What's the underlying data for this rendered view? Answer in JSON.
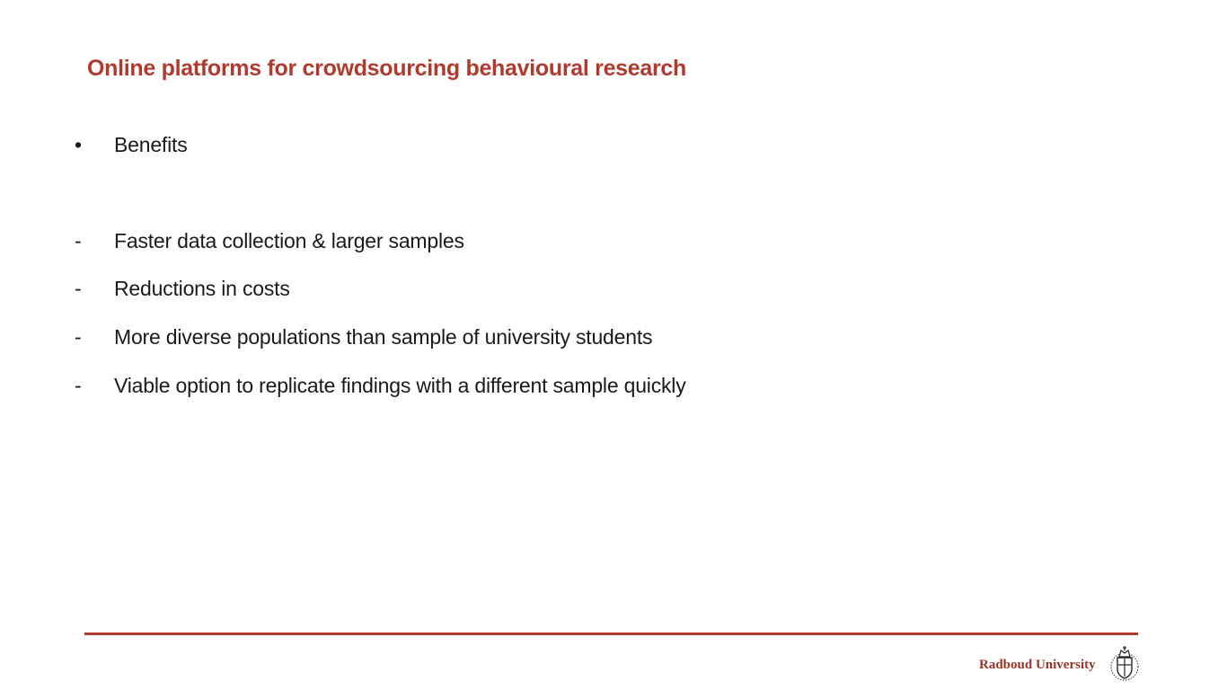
{
  "slide": {
    "title": "Online platforms for crowdsourcing behavioural research",
    "heading_item": {
      "marker": "•",
      "text": "Benefits"
    },
    "items": [
      {
        "marker": "-",
        "text": "Faster data collection & larger samples"
      },
      {
        "marker": "-",
        "text": "Reductions in costs"
      },
      {
        "marker": "-",
        "text": "More diverse populations than sample of university students"
      },
      {
        "marker": "-",
        "text": "Viable option to replicate findings with a different sample quickly"
      }
    ]
  },
  "footer": {
    "brand": "Radboud University",
    "logo_icon": "radboud-crest-icon",
    "accent_color": "#b03a2e"
  }
}
